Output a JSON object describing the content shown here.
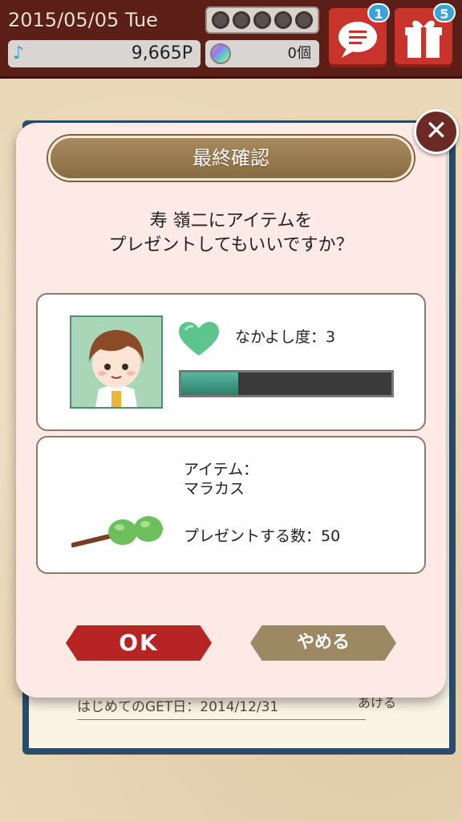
{
  "status_bar": {
    "date": "2015/05/05 Tue",
    "stars_filled": 0,
    "stars_total": 5,
    "points": "9,665P",
    "gems": "0個",
    "chat_badge": "1",
    "gift_badge": "5"
  },
  "dialog": {
    "title": "最終確認",
    "question_line1": "寿 嶺二にアイテムを",
    "question_line2": "プレゼントしてもいいですか？",
    "friendship_label": "なかよし度：3",
    "friendship_progress": 0.27,
    "item_label": "アイテム：",
    "item_name": "マラカス",
    "quantity_label": "プレゼントする数：50",
    "ok_label": "OK",
    "cancel_label": "やめる"
  },
  "background": {
    "first_get_line": "はじめてのGET日：2014/12/31",
    "more_label": "あける"
  },
  "colors": {
    "topbar": "#5b1f17",
    "dialog_bg": "#fde9e6",
    "ok_button": "#b62523",
    "cancel_button": "#9d8864",
    "gauge_fill": "#2e7e69"
  }
}
